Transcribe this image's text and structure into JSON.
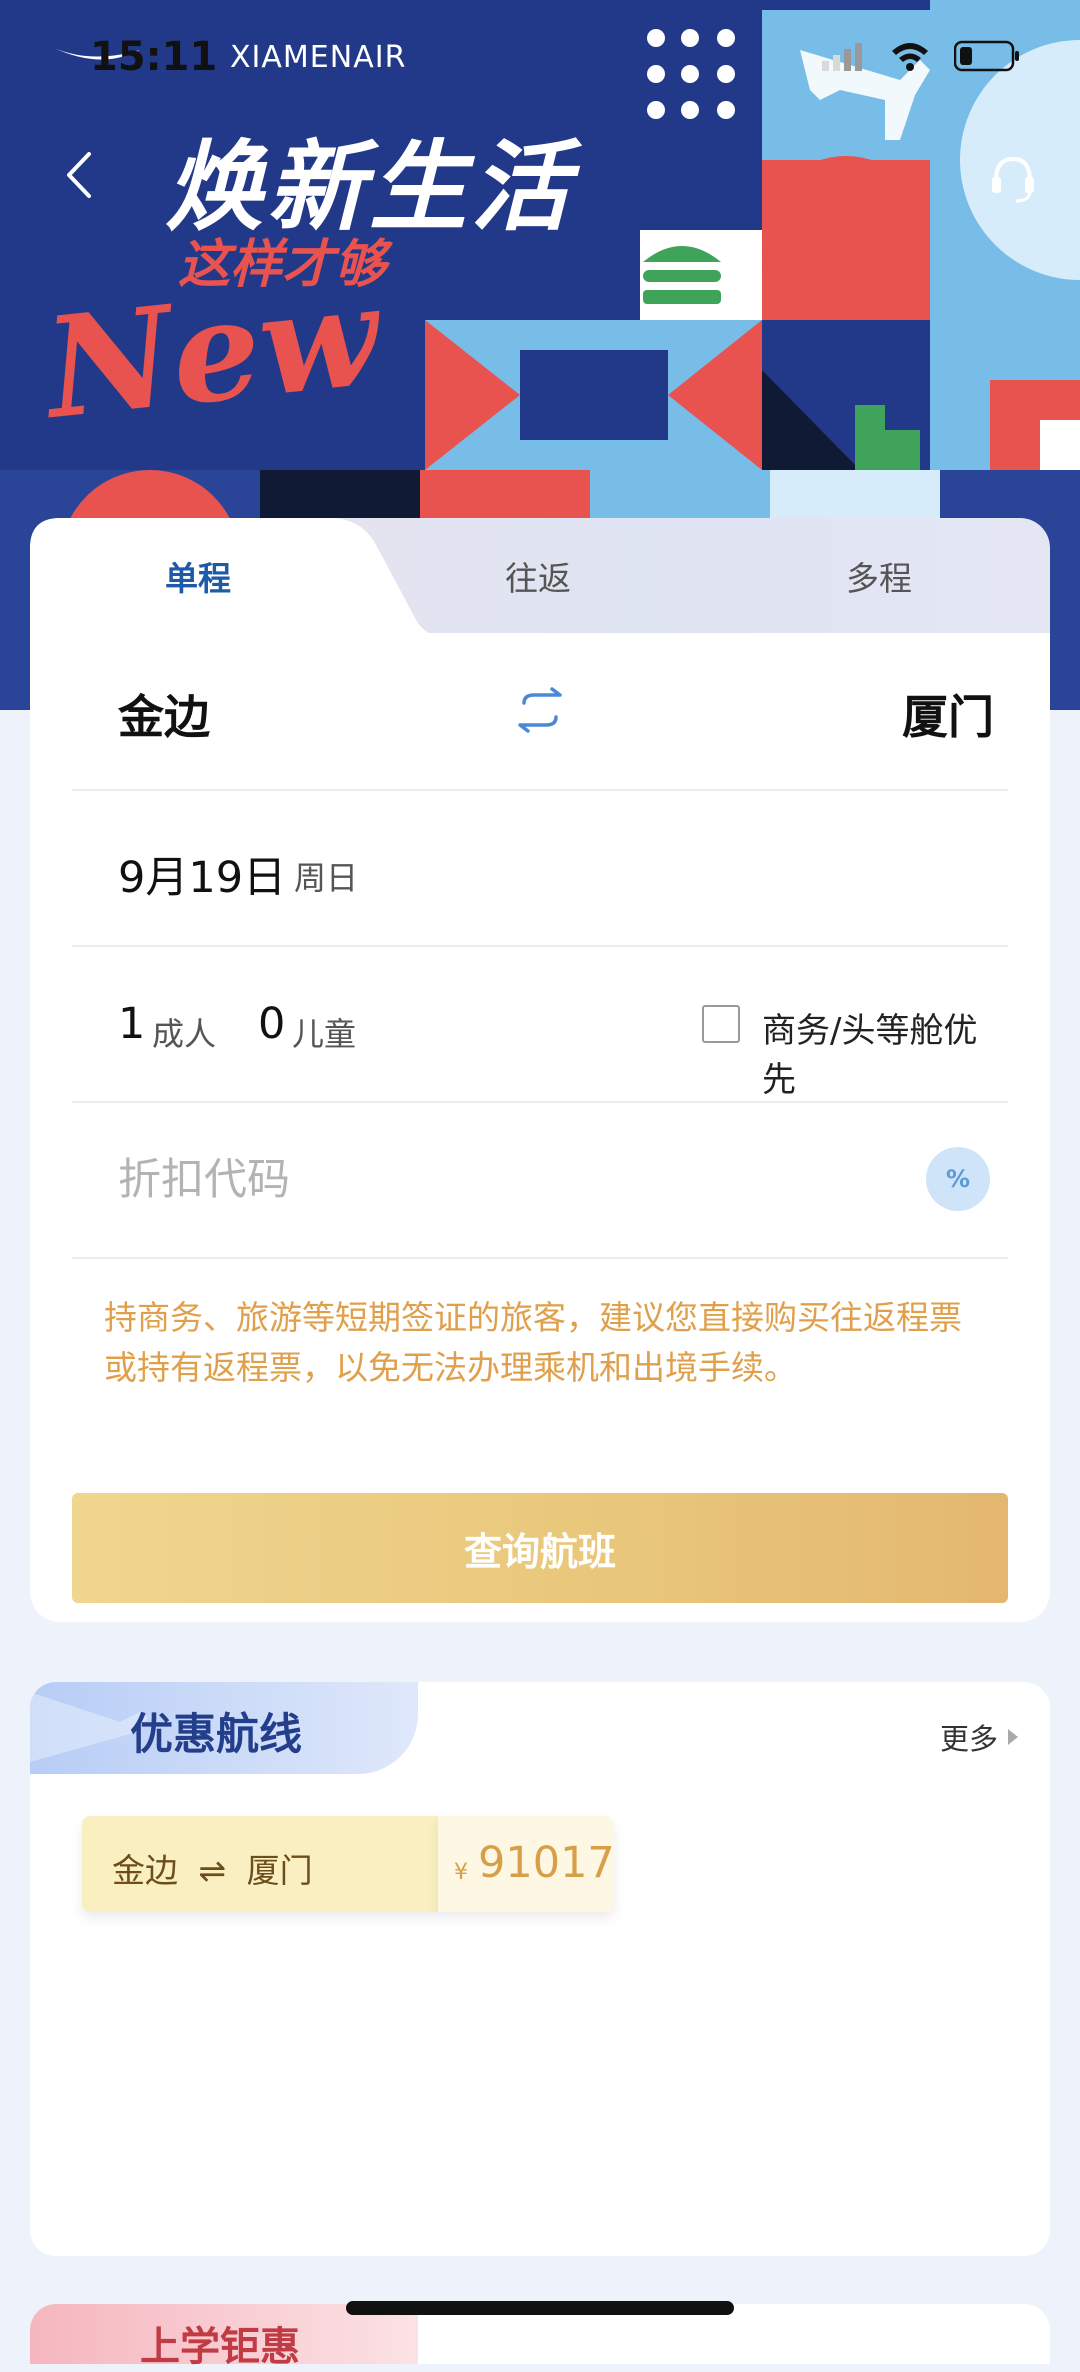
{
  "status_bar": {
    "time": "15:11",
    "brand": "XIAMENAIR"
  },
  "banner": {
    "title": "焕新生活",
    "subtitle": "这样才够",
    "new_text": "New"
  },
  "tabs": [
    {
      "label": "单程",
      "active": true
    },
    {
      "label": "往返",
      "active": false
    },
    {
      "label": "多程",
      "active": false
    }
  ],
  "search": {
    "from_city": "金边",
    "to_city": "厦门",
    "date": "9月19日",
    "weekday": "周日",
    "adults_count": "1",
    "adults_label": "成人",
    "children_count": "0",
    "children_label": "儿童",
    "business_first_label": "商务/头等舱优先",
    "business_first_checked": false,
    "promo_placeholder": "折扣代码",
    "promo_icon": "%",
    "notice": "持商务、旅游等短期签证的旅客，建议您直接购买往返程票或持有返程票，以免无法办理乘机和出境手续。",
    "button_label": "查询航班"
  },
  "deals": {
    "title": "优惠航线",
    "more_label": "更多",
    "routes": [
      {
        "from": "金边",
        "arrow": "⇌",
        "to": "厦门",
        "currency": "¥",
        "price": "91017"
      }
    ]
  },
  "next_section": {
    "title": "上学钜惠"
  },
  "colors": {
    "brand_blue": "#1f3a8c",
    "accent_red": "#e8524f",
    "active_tab": "#1d5aa8",
    "notice": "#e0a04b",
    "button_gold": "#e8c679",
    "price": "#d7a048"
  }
}
